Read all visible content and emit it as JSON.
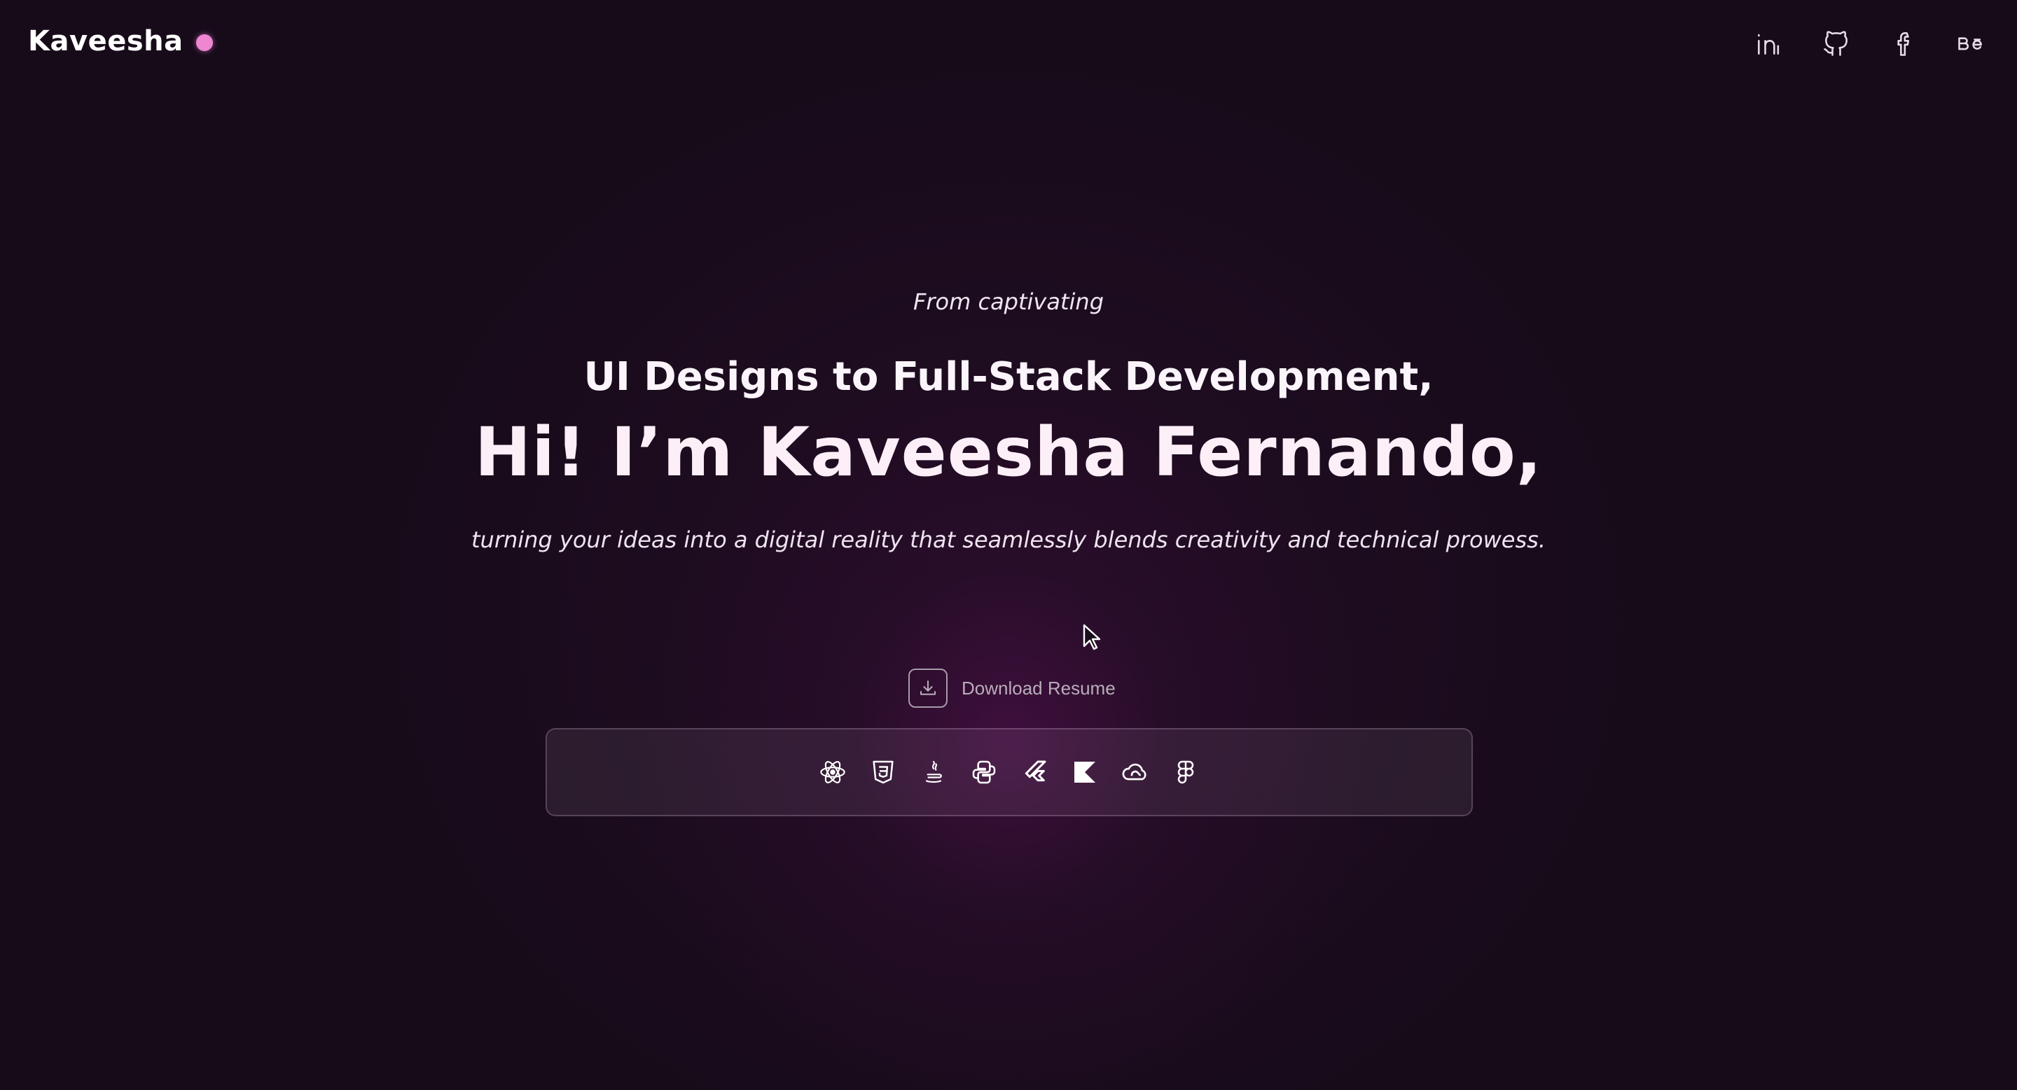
{
  "header": {
    "logo_text": "Kaveesha",
    "accent_color": "#ee86d2",
    "socials": [
      {
        "name": "linkedin-icon"
      },
      {
        "name": "github-icon"
      },
      {
        "name": "facebook-icon"
      },
      {
        "name": "behance-icon"
      }
    ]
  },
  "hero": {
    "intro": "From captivating",
    "subheadline": "UI Designs to Full-Stack Development,",
    "headline": "Hi! I’m Kaveesha Fernando,",
    "tagline": "turning your ideas into a digital reality that seamlessly blends creativity and technical prowess.",
    "download_label": "Download Resume"
  },
  "tech_stack": [
    "react-icon",
    "css3-icon",
    "java-icon",
    "python-icon",
    "flutter-icon",
    "kotlin-icon",
    "adobe-creative-cloud-icon",
    "figma-icon"
  ],
  "colors": {
    "background": "#170b1a",
    "glow": "#561252",
    "text": "#fdeff8"
  }
}
